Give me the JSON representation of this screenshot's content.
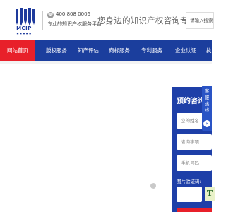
{
  "brand": {
    "name": "MCIP",
    "sub": "■ ■ ■ ■ ■",
    "brand_color": "#1e3a9c"
  },
  "header": {
    "phone": "400 808 0006",
    "tagline": "专业的知识产权服务平台",
    "slogan": "您身边的知识产权咨询专家!",
    "search_placeholder": "请输入搜索内"
  },
  "nav": {
    "items": [
      {
        "label": "网站首页",
        "active": true
      },
      {
        "label": "版权服务"
      },
      {
        "label": "知产评估"
      },
      {
        "label": "商标服务"
      },
      {
        "label": "专利服务"
      },
      {
        "label": "企业认证"
      },
      {
        "label": "执"
      }
    ],
    "bg_color": "#1b3e9d",
    "active_color": "#e8202a"
  },
  "consult_form": {
    "title": "预约咨询",
    "name_placeholder": "您的姓名",
    "topic_placeholder": "咨询事项",
    "phone_placeholder": "手机号码",
    "captcha_label": "图片验证码:",
    "captcha_char": "T"
  },
  "service_tab": {
    "label": "客服热线",
    "toggle_icon": "chevron-left-icon"
  }
}
